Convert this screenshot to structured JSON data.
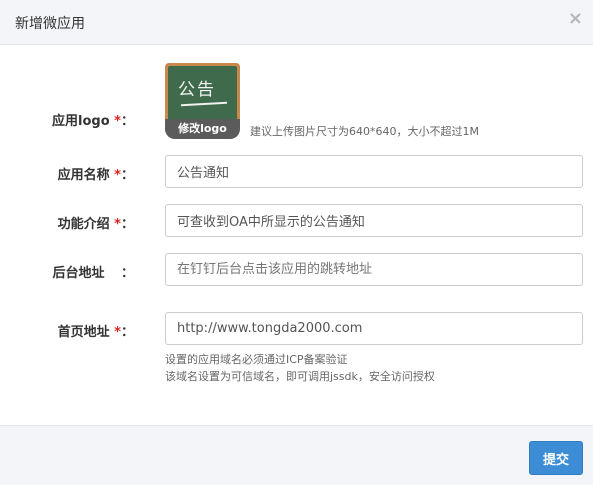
{
  "dialog": {
    "title": "新增微应用",
    "close_glyph": "×"
  },
  "form": {
    "logo": {
      "label": "应用logo",
      "required_mark": "*",
      "colon": "：",
      "image_text": "公告",
      "change_button": "修改logo",
      "hint": "建议上传图片尺寸为640*640，大小不超过1M"
    },
    "name": {
      "label": "应用名称",
      "required_mark": "*",
      "colon": "：",
      "value": "公告通知"
    },
    "intro": {
      "label": "功能介绍",
      "required_mark": "*",
      "colon": "：",
      "value": "可查收到OA中所显示的公告通知"
    },
    "admin_url": {
      "label": "后台地址",
      "colon": "：",
      "placeholder": "在钉钉后台点击该应用的跳转地址"
    },
    "home_url": {
      "label": "首页地址",
      "required_mark": "*",
      "colon": "：",
      "value": "http://www.tongda2000.com",
      "help_line1": "设置的应用域名必须通过ICP备案验证",
      "help_line2": "该域名设置为可信域名，即可调用jssdk，安全访问授权"
    }
  },
  "footer": {
    "submit_label": "提交"
  },
  "colors": {
    "primary_button": "#3c8dd6",
    "required_star": "#e02020",
    "header_bg": "#f3f5f8"
  }
}
